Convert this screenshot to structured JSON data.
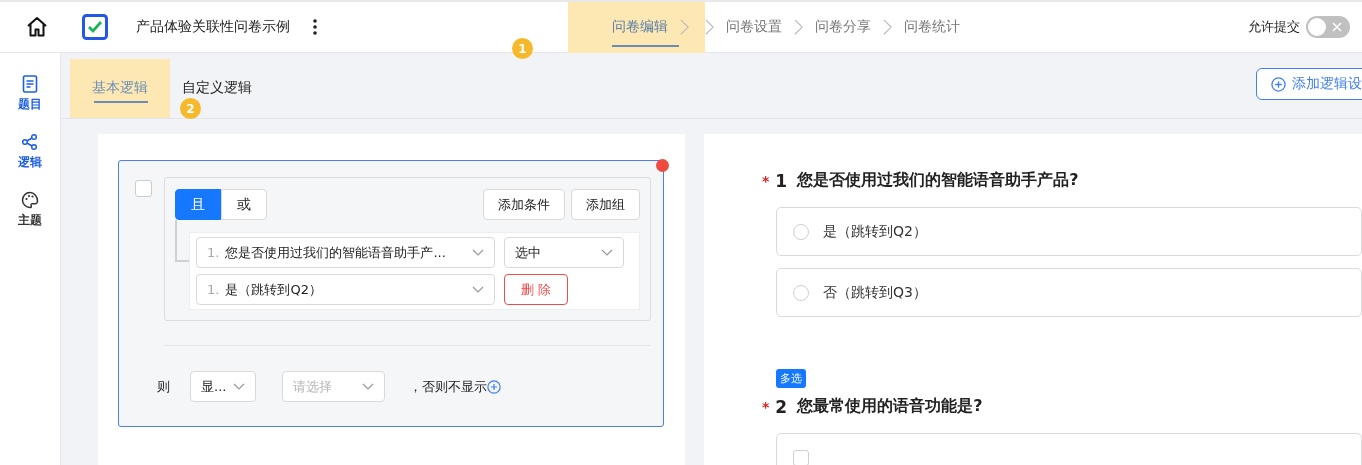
{
  "header": {
    "title": "产品体验关联性问卷示例",
    "steps": [
      {
        "label": "问卷编辑",
        "selected": true,
        "tour_marker": "1"
      },
      {
        "label": "问卷设置",
        "selected": false
      },
      {
        "label": "问卷分享",
        "selected": false
      },
      {
        "label": "问卷统计",
        "selected": false
      }
    ],
    "switch": {
      "label": "允许提交",
      "on": false
    }
  },
  "sidebar": {
    "items": [
      {
        "label": "题目",
        "active": true
      },
      {
        "label": "逻辑",
        "active": true
      },
      {
        "label": "主题",
        "active": false
      }
    ]
  },
  "logic_tabs": [
    {
      "label": "基本逻辑",
      "selected": true,
      "tour_marker": "2"
    },
    {
      "label": "自定义逻辑",
      "selected": false
    }
  ],
  "add_logic_button": "添加逻辑设",
  "rule": {
    "checked": false,
    "conjunctions": [
      {
        "label": "且",
        "selected": true
      },
      {
        "label": "或",
        "selected": false
      }
    ],
    "group_buttons": [
      "添加条件",
      "添加组"
    ],
    "condition": {
      "question": {
        "index": "1.",
        "value": "您是否使用过我们的智能语音助手产..."
      },
      "operator": "选中",
      "option": {
        "index": "1.",
        "value": "是（跳转到Q2）"
      },
      "delete_button": "删 除"
    },
    "then": {
      "label": "则",
      "action": "显...",
      "target_placeholder": "请选择",
      "suffix": "，否则不显示"
    }
  },
  "questions": [
    {
      "number": "1",
      "required_mark": "*",
      "kind": "radio",
      "title": "您是否使用过我们的智能语音助手产品?",
      "options": [
        {
          "label": "是（跳转到Q2）",
          "selected": false
        },
        {
          "label": "否（跳转到Q3）",
          "selected": false
        }
      ]
    },
    {
      "tag": "多选",
      "number": "2",
      "required_mark": "*",
      "kind": "checkbox",
      "title": "您最常使用的语音功能是?",
      "options": [
        {
          "checked": false
        }
      ]
    }
  ]
}
